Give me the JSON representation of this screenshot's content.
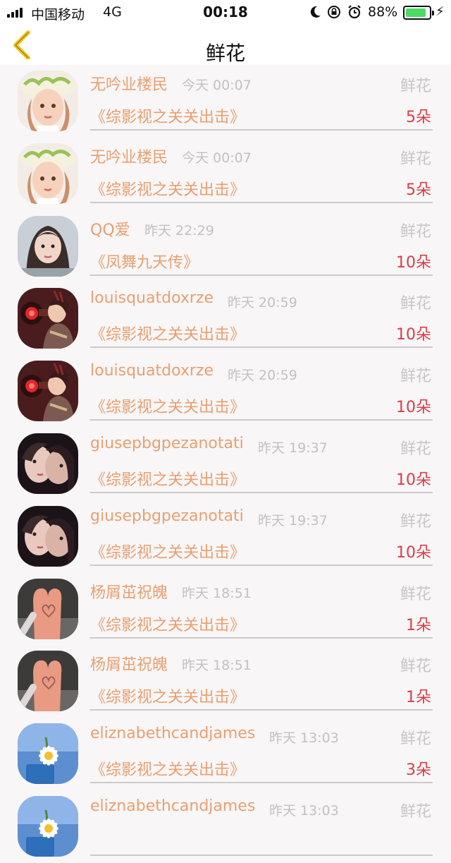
{
  "status": {
    "carrier": "中国移动",
    "network": "4G",
    "time": "00:18",
    "battery": "88%",
    "battery_level": 0.88,
    "battery_color": "#4cd964"
  },
  "nav": {
    "title": "鲜花",
    "back_icon": "chevron-left-icon",
    "back_color": "#f5c518"
  },
  "list": [
    {
      "user": "无吟业楼民",
      "time": "今天 00:07",
      "type": "鲜花",
      "book": "《综影视之关关出击》",
      "amount": "5朵",
      "avatar": "straw-hat-girl"
    },
    {
      "user": "无吟业楼民",
      "time": "今天 00:07",
      "type": "鲜花",
      "book": "《综影视之关关出击》",
      "amount": "5朵",
      "avatar": "straw-hat-girl"
    },
    {
      "user": "QQ爱",
      "time": "昨天 22:29",
      "type": "鲜花",
      "book": "《凤舞九天传》",
      "amount": "10朵",
      "avatar": "girl-portrait"
    },
    {
      "user": "louisquatdoxrze",
      "time": "昨天 20:59",
      "type": "鲜花",
      "book": "《综影视之关关出击》",
      "amount": "10朵",
      "avatar": "game-character"
    },
    {
      "user": "louisquatdoxrze",
      "time": "昨天 20:59",
      "type": "鲜花",
      "book": "《综影视之关关出击》",
      "amount": "10朵",
      "avatar": "game-character"
    },
    {
      "user": "giusepbgpezanotati",
      "time": "昨天 19:37",
      "type": "鲜花",
      "book": "《综影视之关关出击》",
      "amount": "10朵",
      "avatar": "couple-photo"
    },
    {
      "user": "giusepbgpezanotati",
      "time": "昨天 19:37",
      "type": "鲜花",
      "book": "《综影视之关关出击》",
      "amount": "10朵",
      "avatar": "couple-photo"
    },
    {
      "user": "杨屑茁祝魄",
      "time": "昨天 18:51",
      "type": "鲜花",
      "book": "《综影视之关关出击》",
      "amount": "1朵",
      "avatar": "heart-fingers"
    },
    {
      "user": "杨屑茁祝魄",
      "time": "昨天 18:51",
      "type": "鲜花",
      "book": "《综影视之关关出击》",
      "amount": "1朵",
      "avatar": "heart-fingers"
    },
    {
      "user": "eliznabethcandjames",
      "time": "昨天 13:03",
      "type": "鲜花",
      "book": "《综影视之关关出击》",
      "amount": "3朵",
      "avatar": "daisy-flower"
    },
    {
      "user": "eliznabethcandjames",
      "time": "昨天 13:03",
      "type": "鲜花",
      "book": "",
      "amount": "",
      "avatar": "daisy-flower"
    }
  ]
}
